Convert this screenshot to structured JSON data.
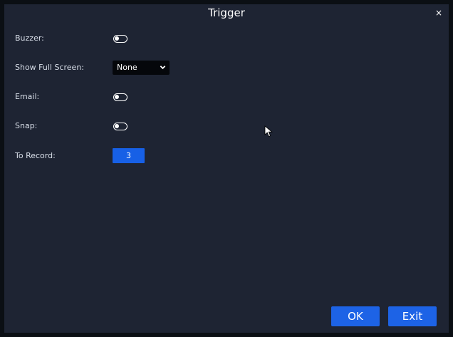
{
  "dialog": {
    "title": "Trigger",
    "close_glyph": "×"
  },
  "fields": {
    "buzzer": {
      "label": "Buzzer:",
      "enabled": false
    },
    "show_full_screen": {
      "label": "Show Full Screen:",
      "value": "None"
    },
    "email": {
      "label": "Email:",
      "enabled": false
    },
    "snap": {
      "label": "Snap:",
      "enabled": false
    },
    "to_record": {
      "label": "To Record:",
      "value": "3"
    }
  },
  "buttons": {
    "ok": "OK",
    "exit": "Exit"
  },
  "icons": {
    "close": "close-icon",
    "dropdown": "chevron-down-icon",
    "pointer": "mouse-pointer-icon"
  },
  "colors": {
    "background": "#1e2433",
    "accent": "#1d63e6",
    "select_bg": "#05070b",
    "text": "#ffffff"
  }
}
